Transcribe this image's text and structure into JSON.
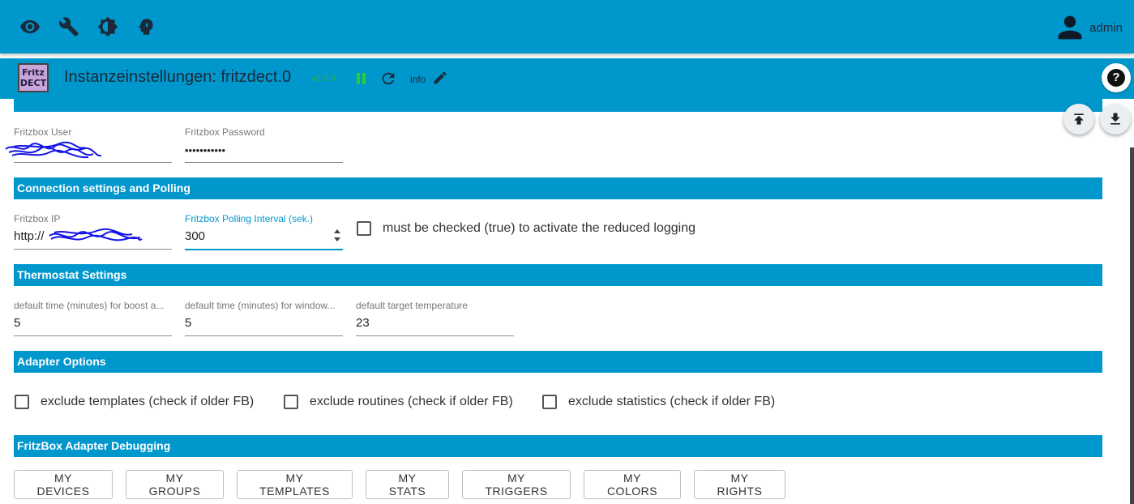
{
  "topbar": {
    "icons": [
      "eye-icon",
      "wrench-icon",
      "brightness-icon",
      "head-icon"
    ],
    "user": {
      "name": "admin",
      "icon": "person-icon"
    }
  },
  "header": {
    "logo_line1": "Fritz",
    "logo_line2": "DECT",
    "title": "Instanzeinstellungen: fritzdect.0",
    "version": "v2.5.9",
    "info_label": "info",
    "help_label": "?"
  },
  "fields_top": {
    "user_label": "Fritzbox User",
    "password_label": "Fritzbox Password",
    "password_value": "•••••••••••"
  },
  "sections": {
    "connection": "Connection settings and Polling",
    "thermostat": "Thermostat Settings",
    "adapter_options": "Adapter Options",
    "debugging": "FritzBox Adapter Debugging"
  },
  "connection": {
    "ip_label": "Fritzbox IP",
    "ip_value": "http://",
    "poll_label": "Fritzbox Polling Interval (sek.)",
    "poll_value": "300",
    "reduced_logging_label": "must be checked (true) to activate the reduced logging",
    "reduced_logging_checked": false
  },
  "thermostat": {
    "boost_label": "default time (minutes) for boost a...",
    "boost_value": "5",
    "window_label": "default time (minutes) for window...",
    "window_value": "5",
    "target_label": "default target temperature",
    "target_value": "23"
  },
  "adapter_options": [
    {
      "label": "exclude templates (check if older FB)",
      "checked": false
    },
    {
      "label": "exclude routines (check if older FB)",
      "checked": false
    },
    {
      "label": "exclude statistics (check if older FB)",
      "checked": false
    }
  ],
  "debug_buttons": [
    "MY DEVICES",
    "MY GROUPS",
    "MY TEMPLATES",
    "MY STATS",
    "MY TRIGGERS",
    "MY COLORS",
    "MY RIGHTS"
  ],
  "colors": {
    "accent": "#0097cd",
    "version": "#22b14c",
    "pause": "#2dcc30"
  }
}
